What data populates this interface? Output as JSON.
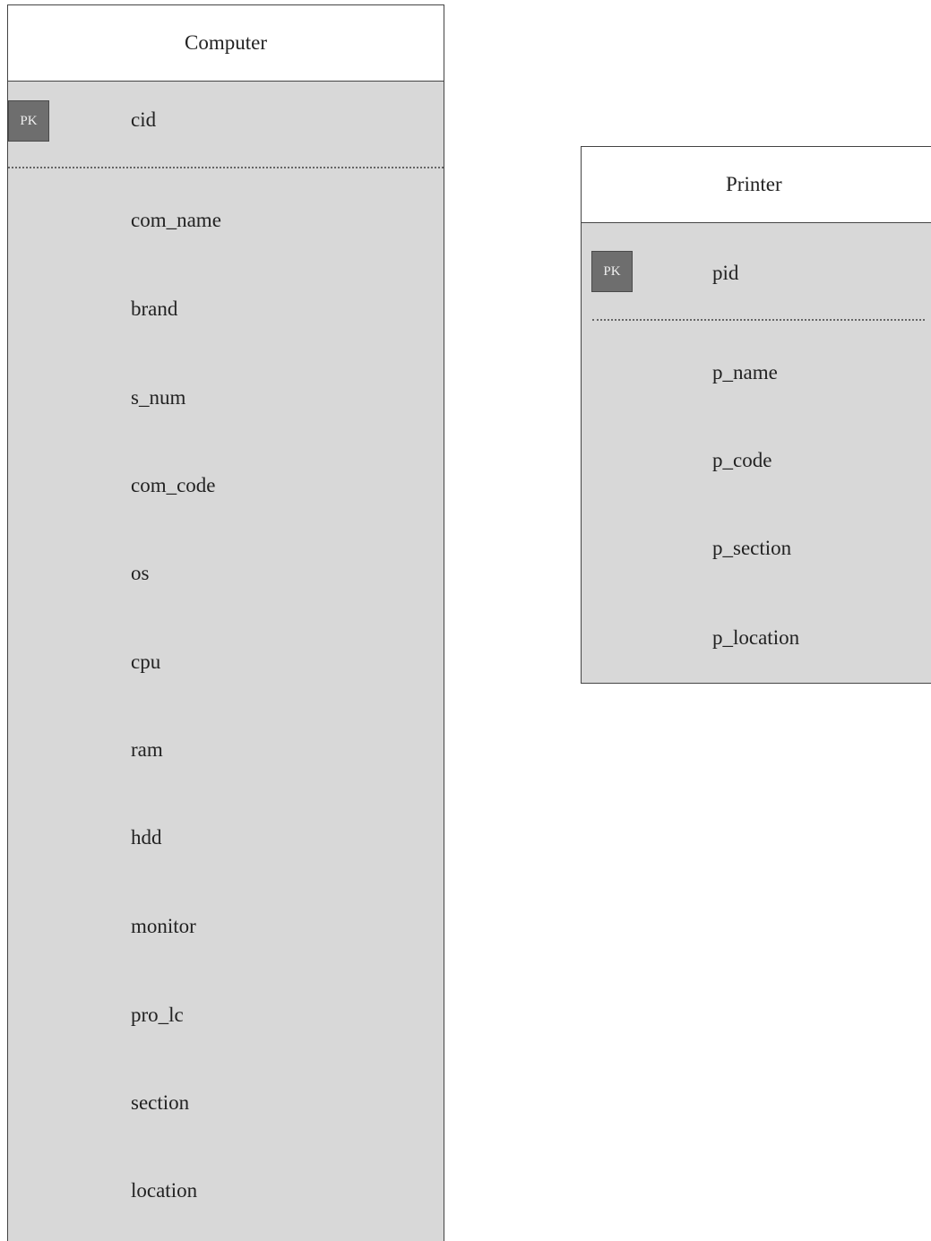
{
  "entities": {
    "computer": {
      "name": "Computer",
      "pk_label": "PK",
      "pk_field": "cid",
      "fields": [
        "com_name",
        "brand",
        "s_num",
        "com_code",
        "os",
        "cpu",
        "ram",
        "hdd",
        "monitor",
        "pro_lc",
        "section",
        "location"
      ]
    },
    "printer": {
      "name": "Printer",
      "pk_label": "PK",
      "pk_field": "pid",
      "fields": [
        "p_name",
        "p_code",
        "p_section",
        "p_location"
      ]
    }
  }
}
